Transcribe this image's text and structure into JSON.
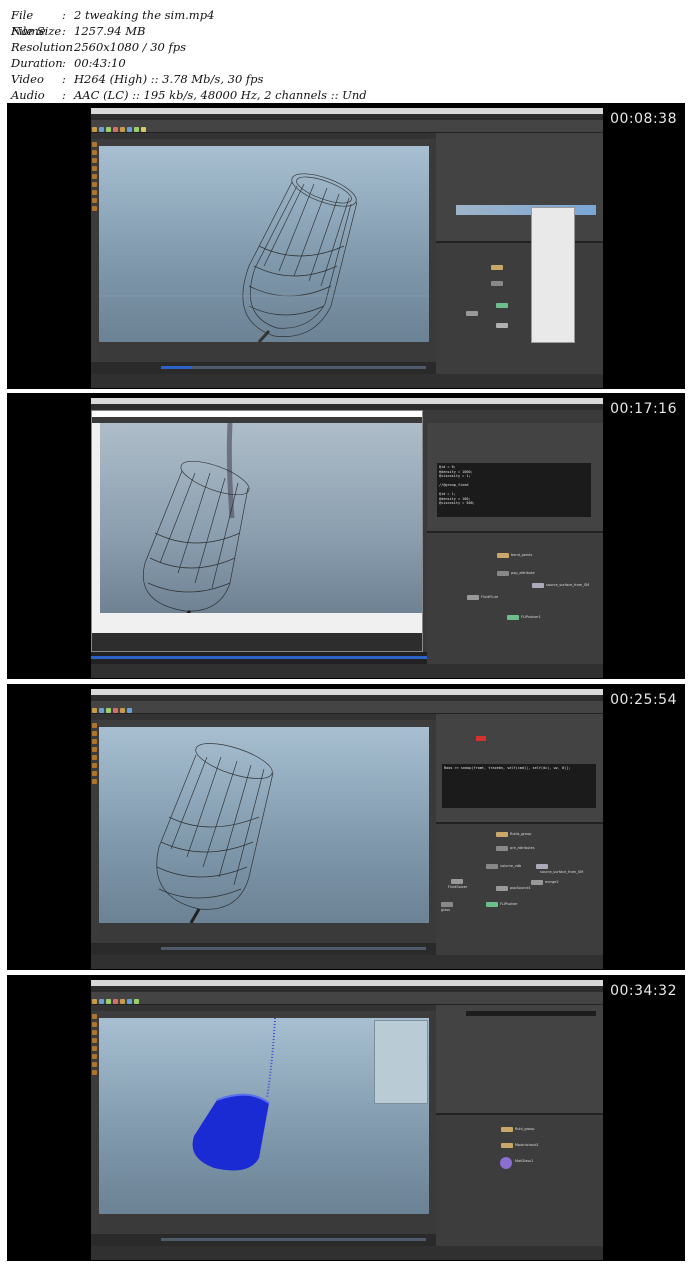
{
  "info": {
    "rows": [
      {
        "key": "File Name",
        "value": "2 tweaking the sim.mp4"
      },
      {
        "key": "File Size",
        "value": "1257.94 MB"
      },
      {
        "key": "Resolution",
        "value": "2560x1080 / 30 fps"
      },
      {
        "key": "Duration",
        "value": "00:43:10"
      },
      {
        "key": "Video",
        "value": "H264 (High) :: 3.78 Mb/s, 30 fps"
      },
      {
        "key": "Audio",
        "value": "AAC (LC) :: 195 kb/s, 48000 Hz, 2 channels :: Und"
      }
    ],
    "colon": ":"
  },
  "thumbnails": [
    {
      "timestamp": "00:08:38"
    },
    {
      "timestamp": "00:17:16"
    },
    {
      "timestamp": "00:25:54"
    },
    {
      "timestamp": "00:34:32"
    }
  ],
  "code_snippets": {
    "t2": "@id = 0;\n@density = 1000;\n@viscosity = 1;\n\n//@group_fixed\n\n@id = 1;\n@density = 100;\n@viscosity = 500;",
    "t3": "Roos >> snoop(fromt, tracebn, self(cmd)), self(dc), wv, 0)[;"
  },
  "node_labels": {
    "t2": [
      "bend_points",
      "pop_attribute",
      "source_surface_from_SM",
      "FluidFluid",
      "FLIPsolver1"
    ],
    "t3": [
      "fluids_group",
      "pre_attributes",
      "volume_vdb",
      "source_surface_from_SM",
      "FluidSolver",
      "popSource1",
      "merge2",
      "glass",
      "FLIPsolver"
    ],
    "t4": [
      "fluid_group",
      "Mpointcloud1",
      "MatGlass1"
    ]
  },
  "colors": {
    "viewport_top": "#a7bfd1",
    "viewport_bottom": "#6c8295",
    "particles": "#1a2bd4",
    "timeline_accent": "#2d62c9"
  }
}
